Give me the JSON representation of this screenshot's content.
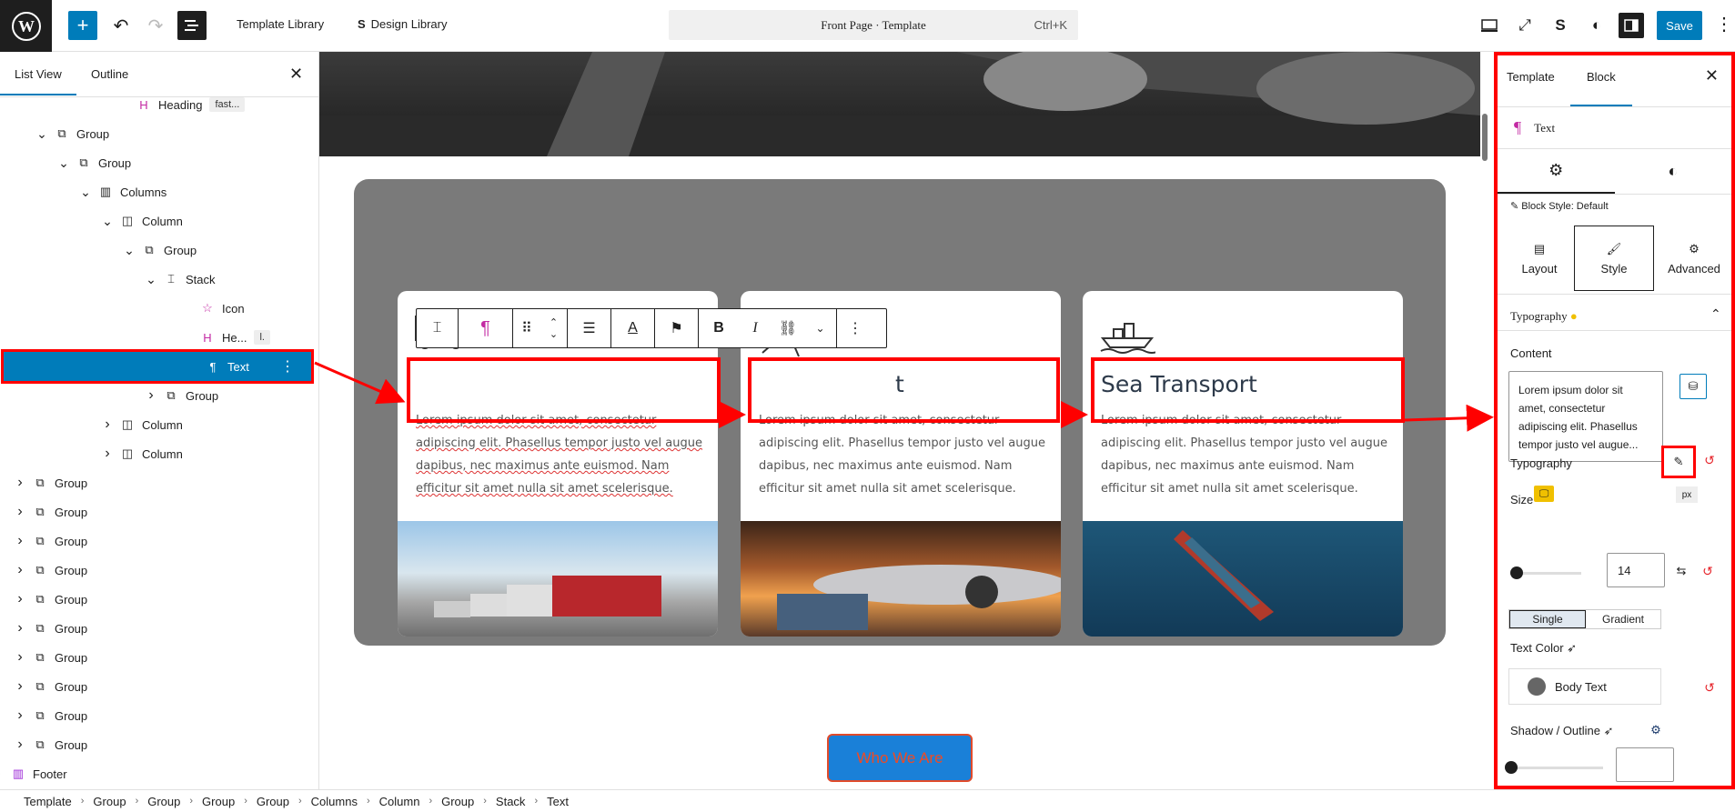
{
  "topbar": {
    "template_library": "Template Library",
    "design_library": "Design Library",
    "doc_title": "Front Page · Template",
    "shortcut": "Ctrl+K",
    "save": "Save"
  },
  "list_view": {
    "tab_list": "List View",
    "tab_outline": "Outline",
    "rows": [
      {
        "label": "Heading",
        "badge": "fast...",
        "icon": "heading-icon"
      },
      {
        "label": "Group"
      },
      {
        "label": "Group"
      },
      {
        "label": "Columns"
      },
      {
        "label": "Column"
      },
      {
        "label": "Group"
      },
      {
        "label": "Stack"
      },
      {
        "label": "Icon"
      },
      {
        "label": "He...",
        "badge": "l."
      },
      {
        "label": "Text"
      },
      {
        "label": "Group"
      },
      {
        "label": "Column"
      },
      {
        "label": "Column"
      },
      {
        "label": "Group"
      },
      {
        "label": "Group"
      },
      {
        "label": "Group"
      },
      {
        "label": "Group"
      },
      {
        "label": "Group"
      },
      {
        "label": "Group"
      },
      {
        "label": "Group"
      },
      {
        "label": "Group"
      },
      {
        "label": "Group"
      },
      {
        "label": "Group"
      },
      {
        "label": "Footer"
      }
    ]
  },
  "cards": [
    {
      "title": "",
      "text": "Lorem ipsum dolor sit amet, consectetur adipiscing elit. Phasellus tempor justo vel augue dapibus, nec maximus ante euismod. Nam efficitur sit amet nulla sit amet scelerisque."
    },
    {
      "title": "t",
      "text": "Lorem ipsum dolor sit amet, consectetur adipiscing elit. Phasellus tempor justo vel augue dapibus, nec maximus ante euismod. Nam efficitur sit amet nulla sit amet scelerisque."
    },
    {
      "title": "Sea Transport",
      "text": "Lorem ipsum dolor sit amet, consectetur adipiscing elit. Phasellus tempor justo vel augue dapibus, nec maximus ante euismod. Nam efficitur sit amet nulla sit amet scelerisque."
    }
  ],
  "who_button": "Who We Are",
  "settings": {
    "tab_template": "Template",
    "tab_block": "Block",
    "block_name": "Text",
    "block_style": "Block Style: Default",
    "seg_layout": "Layout",
    "seg_style": "Style",
    "seg_advanced": "Advanced",
    "typography_header": "Typography",
    "content_label": "Content",
    "content_value": "Lorem ipsum dolor sit amet, consectetur adipiscing elit. Phasellus tempor justo vel augue...",
    "typography_label": "Typography",
    "size_label": "Size",
    "size_unit": "px",
    "size_value": "14",
    "toggle_single": "Single",
    "toggle_gradient": "Gradient",
    "text_color_label": "Text Color",
    "color_name": "Body Text",
    "shadow_label": "Shadow / Outline"
  },
  "breadcrumb": [
    "Template",
    "Group",
    "Group",
    "Group",
    "Group",
    "Columns",
    "Column",
    "Group",
    "Stack",
    "Text"
  ],
  "colors": {
    "accent": "#007cba",
    "highlight": "#ff0000"
  }
}
